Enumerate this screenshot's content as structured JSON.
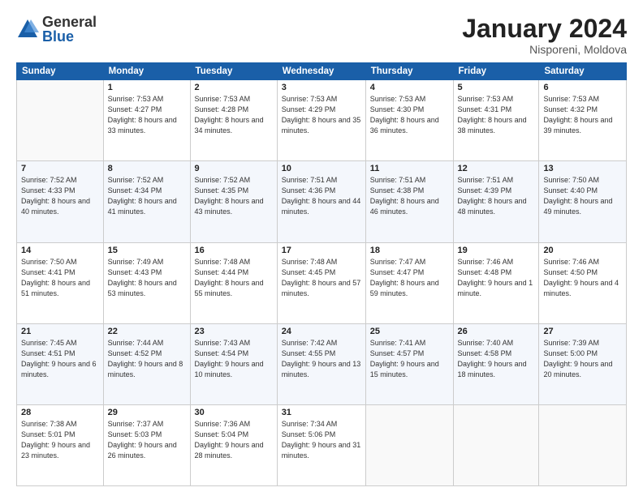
{
  "logo": {
    "general": "General",
    "blue": "Blue"
  },
  "header": {
    "month": "January 2024",
    "location": "Nisporeni, Moldova"
  },
  "weekdays": [
    "Sunday",
    "Monday",
    "Tuesday",
    "Wednesday",
    "Thursday",
    "Friday",
    "Saturday"
  ],
  "weeks": [
    [
      {
        "day": "",
        "sunrise": "",
        "sunset": "",
        "daylight": ""
      },
      {
        "day": "1",
        "sunrise": "Sunrise: 7:53 AM",
        "sunset": "Sunset: 4:27 PM",
        "daylight": "Daylight: 8 hours and 33 minutes."
      },
      {
        "day": "2",
        "sunrise": "Sunrise: 7:53 AM",
        "sunset": "Sunset: 4:28 PM",
        "daylight": "Daylight: 8 hours and 34 minutes."
      },
      {
        "day": "3",
        "sunrise": "Sunrise: 7:53 AM",
        "sunset": "Sunset: 4:29 PM",
        "daylight": "Daylight: 8 hours and 35 minutes."
      },
      {
        "day": "4",
        "sunrise": "Sunrise: 7:53 AM",
        "sunset": "Sunset: 4:30 PM",
        "daylight": "Daylight: 8 hours and 36 minutes."
      },
      {
        "day": "5",
        "sunrise": "Sunrise: 7:53 AM",
        "sunset": "Sunset: 4:31 PM",
        "daylight": "Daylight: 8 hours and 38 minutes."
      },
      {
        "day": "6",
        "sunrise": "Sunrise: 7:53 AM",
        "sunset": "Sunset: 4:32 PM",
        "daylight": "Daylight: 8 hours and 39 minutes."
      }
    ],
    [
      {
        "day": "7",
        "sunrise": "Sunrise: 7:52 AM",
        "sunset": "Sunset: 4:33 PM",
        "daylight": "Daylight: 8 hours and 40 minutes."
      },
      {
        "day": "8",
        "sunrise": "Sunrise: 7:52 AM",
        "sunset": "Sunset: 4:34 PM",
        "daylight": "Daylight: 8 hours and 41 minutes."
      },
      {
        "day": "9",
        "sunrise": "Sunrise: 7:52 AM",
        "sunset": "Sunset: 4:35 PM",
        "daylight": "Daylight: 8 hours and 43 minutes."
      },
      {
        "day": "10",
        "sunrise": "Sunrise: 7:51 AM",
        "sunset": "Sunset: 4:36 PM",
        "daylight": "Daylight: 8 hours and 44 minutes."
      },
      {
        "day": "11",
        "sunrise": "Sunrise: 7:51 AM",
        "sunset": "Sunset: 4:38 PM",
        "daylight": "Daylight: 8 hours and 46 minutes."
      },
      {
        "day": "12",
        "sunrise": "Sunrise: 7:51 AM",
        "sunset": "Sunset: 4:39 PM",
        "daylight": "Daylight: 8 hours and 48 minutes."
      },
      {
        "day": "13",
        "sunrise": "Sunrise: 7:50 AM",
        "sunset": "Sunset: 4:40 PM",
        "daylight": "Daylight: 8 hours and 49 minutes."
      }
    ],
    [
      {
        "day": "14",
        "sunrise": "Sunrise: 7:50 AM",
        "sunset": "Sunset: 4:41 PM",
        "daylight": "Daylight: 8 hours and 51 minutes."
      },
      {
        "day": "15",
        "sunrise": "Sunrise: 7:49 AM",
        "sunset": "Sunset: 4:43 PM",
        "daylight": "Daylight: 8 hours and 53 minutes."
      },
      {
        "day": "16",
        "sunrise": "Sunrise: 7:48 AM",
        "sunset": "Sunset: 4:44 PM",
        "daylight": "Daylight: 8 hours and 55 minutes."
      },
      {
        "day": "17",
        "sunrise": "Sunrise: 7:48 AM",
        "sunset": "Sunset: 4:45 PM",
        "daylight": "Daylight: 8 hours and 57 minutes."
      },
      {
        "day": "18",
        "sunrise": "Sunrise: 7:47 AM",
        "sunset": "Sunset: 4:47 PM",
        "daylight": "Daylight: 8 hours and 59 minutes."
      },
      {
        "day": "19",
        "sunrise": "Sunrise: 7:46 AM",
        "sunset": "Sunset: 4:48 PM",
        "daylight": "Daylight: 9 hours and 1 minute."
      },
      {
        "day": "20",
        "sunrise": "Sunrise: 7:46 AM",
        "sunset": "Sunset: 4:50 PM",
        "daylight": "Daylight: 9 hours and 4 minutes."
      }
    ],
    [
      {
        "day": "21",
        "sunrise": "Sunrise: 7:45 AM",
        "sunset": "Sunset: 4:51 PM",
        "daylight": "Daylight: 9 hours and 6 minutes."
      },
      {
        "day": "22",
        "sunrise": "Sunrise: 7:44 AM",
        "sunset": "Sunset: 4:52 PM",
        "daylight": "Daylight: 9 hours and 8 minutes."
      },
      {
        "day": "23",
        "sunrise": "Sunrise: 7:43 AM",
        "sunset": "Sunset: 4:54 PM",
        "daylight": "Daylight: 9 hours and 10 minutes."
      },
      {
        "day": "24",
        "sunrise": "Sunrise: 7:42 AM",
        "sunset": "Sunset: 4:55 PM",
        "daylight": "Daylight: 9 hours and 13 minutes."
      },
      {
        "day": "25",
        "sunrise": "Sunrise: 7:41 AM",
        "sunset": "Sunset: 4:57 PM",
        "daylight": "Daylight: 9 hours and 15 minutes."
      },
      {
        "day": "26",
        "sunrise": "Sunrise: 7:40 AM",
        "sunset": "Sunset: 4:58 PM",
        "daylight": "Daylight: 9 hours and 18 minutes."
      },
      {
        "day": "27",
        "sunrise": "Sunrise: 7:39 AM",
        "sunset": "Sunset: 5:00 PM",
        "daylight": "Daylight: 9 hours and 20 minutes."
      }
    ],
    [
      {
        "day": "28",
        "sunrise": "Sunrise: 7:38 AM",
        "sunset": "Sunset: 5:01 PM",
        "daylight": "Daylight: 9 hours and 23 minutes."
      },
      {
        "day": "29",
        "sunrise": "Sunrise: 7:37 AM",
        "sunset": "Sunset: 5:03 PM",
        "daylight": "Daylight: 9 hours and 26 minutes."
      },
      {
        "day": "30",
        "sunrise": "Sunrise: 7:36 AM",
        "sunset": "Sunset: 5:04 PM",
        "daylight": "Daylight: 9 hours and 28 minutes."
      },
      {
        "day": "31",
        "sunrise": "Sunrise: 7:34 AM",
        "sunset": "Sunset: 5:06 PM",
        "daylight": "Daylight: 9 hours and 31 minutes."
      },
      {
        "day": "",
        "sunrise": "",
        "sunset": "",
        "daylight": ""
      },
      {
        "day": "",
        "sunrise": "",
        "sunset": "",
        "daylight": ""
      },
      {
        "day": "",
        "sunrise": "",
        "sunset": "",
        "daylight": ""
      }
    ]
  ]
}
